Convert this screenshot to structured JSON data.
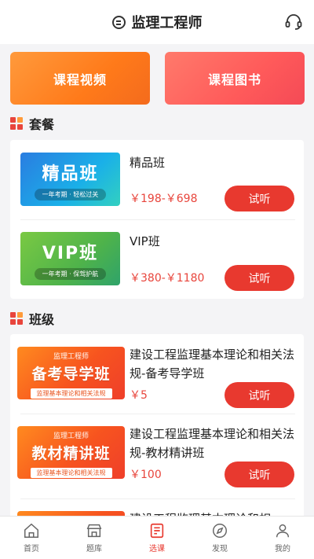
{
  "header": {
    "title": "监理工程师"
  },
  "categories": [
    {
      "label": "课程视频"
    },
    {
      "label": "课程图书"
    }
  ],
  "packages": {
    "title": "套餐",
    "items": [
      {
        "thumb_big": "精品班",
        "thumb_sub": "一年考期 · 轻松过关",
        "name": "精品班",
        "price": "￥198-￥698",
        "button": "试听"
      },
      {
        "thumb_big": "VIP班",
        "thumb_sub": "一年考期 · 保驾护航",
        "name": "VIP班",
        "price": "￥380-￥1180",
        "button": "试听"
      }
    ]
  },
  "classes": {
    "title": "班级",
    "items": [
      {
        "thumb_brand": "监理工程师",
        "thumb_big": "备考导学班",
        "thumb_band": "监理基本理论和相关法规",
        "name": "建设工程监理基本理论和相关法规-备考导学班",
        "price": "￥5",
        "button": "试听"
      },
      {
        "thumb_brand": "监理工程师",
        "thumb_big": "教材精讲班",
        "thumb_band": "监理基本理论和相关法规",
        "name": "建设工程监理基本理论和相关法规-教材精讲班",
        "price": "￥100",
        "button": "试听"
      },
      {
        "name": "建设工程监理基本理论和相"
      }
    ]
  },
  "tabbar": {
    "tabs": [
      {
        "label": "首页",
        "icon": "home-icon"
      },
      {
        "label": "题库",
        "icon": "store-icon"
      },
      {
        "label": "选课",
        "icon": "course-icon",
        "active": true
      },
      {
        "label": "发现",
        "icon": "discover-icon"
      },
      {
        "label": "我的",
        "icon": "profile-icon"
      }
    ]
  },
  "colors": {
    "accent": "#e8392f",
    "price": "#e8453c"
  }
}
